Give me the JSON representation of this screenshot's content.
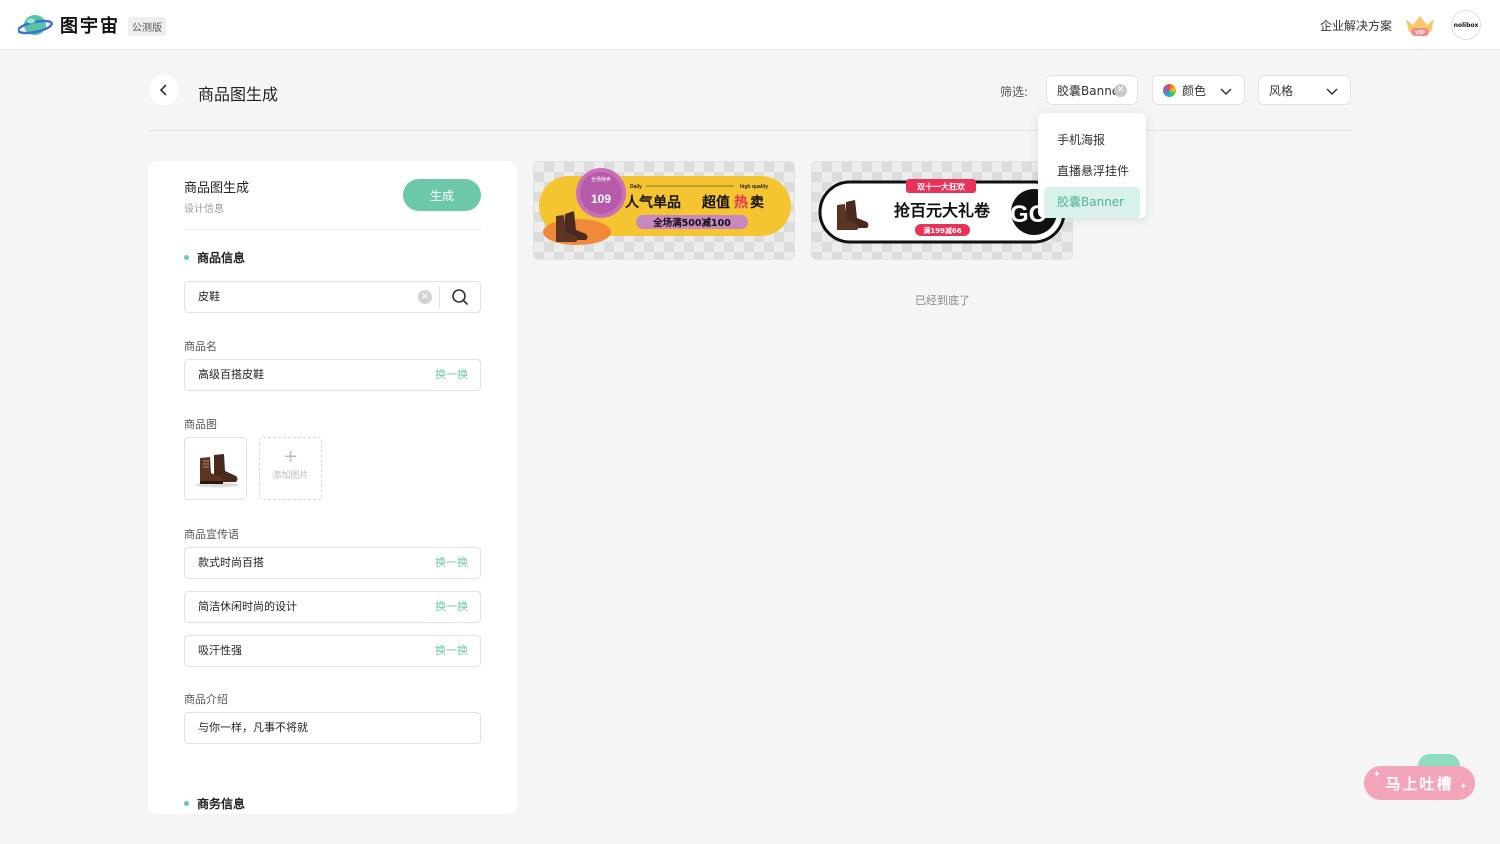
{
  "header": {
    "brand": "图宇宙",
    "beta_badge": "公测版",
    "enterprise_link": "企业解决方案",
    "vip_label": "VIP",
    "avatar_text": "nolibox"
  },
  "page": {
    "title": "商品图生成",
    "filter_label": "筛选:",
    "filters": {
      "type_value": "胶囊Banner",
      "color_label": "颜色",
      "style_label": "风格"
    },
    "dropdown": [
      "手机海报",
      "直播悬浮挂件",
      "胶囊Banner"
    ],
    "end_text": "已经到底了"
  },
  "panel": {
    "title": "商品图生成",
    "subtitle": "设计信息",
    "generate_button": "生成",
    "section_product": "商品信息",
    "search_value": "皮鞋",
    "name_label": "商品名",
    "name_value": "高级百搭皮鞋",
    "swap_label": "换一换",
    "image_label": "商品图",
    "add_image": "添加图片",
    "slogan_label": "商品宣传语",
    "slogans": [
      "款式时尚百搭",
      "简洁休闲时尚的设计",
      "吸汗性强"
    ],
    "intro_label": "商品介绍",
    "intro_value": "与你一样，凡事不将就",
    "section_business": "商务信息"
  },
  "banners": [
    {
      "badge_top": "全场特卖",
      "badge_num": "109",
      "tag_left": "Daily",
      "tag_right": "high quality",
      "headline_a": "人气单品",
      "headline_b": "超值",
      "headline_hot": "热",
      "headline_c": "卖",
      "promo": "全场满500减100"
    },
    {
      "tag": "双十一大狂欢",
      "headline": "抢百元大礼卷",
      "promo": "满199减66",
      "go": "GO"
    }
  ],
  "feedback": "马上吐槽",
  "colors": {
    "accent": "#6dc8ab",
    "banner_yellow": "#f5c531",
    "banner_pink": "#e8325a",
    "feedback_pink": "#f2a4b8"
  }
}
